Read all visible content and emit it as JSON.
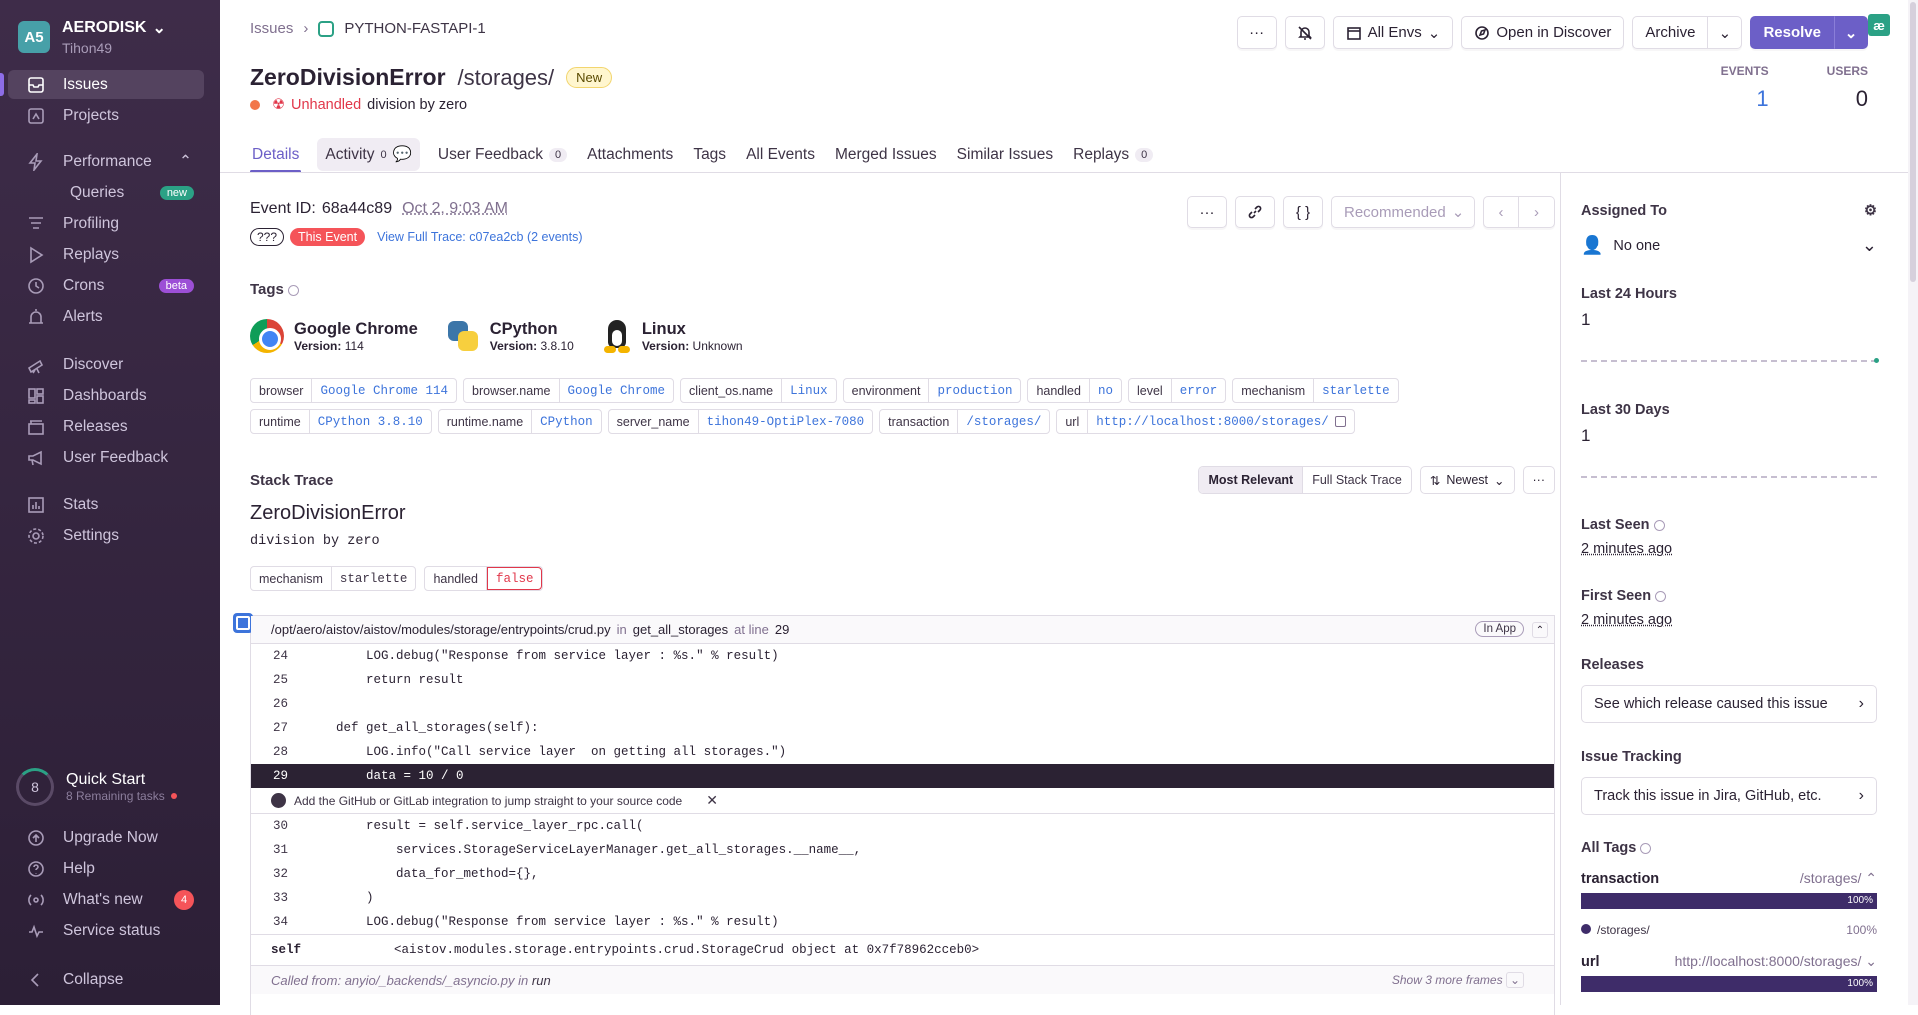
{
  "org": {
    "initials": "A5",
    "name": "AERODISK",
    "user": "Tihon49"
  },
  "nav": {
    "issues": "Issues",
    "projects": "Projects",
    "performance": "Performance",
    "queries": "Queries",
    "queries_badge": "new",
    "profiling": "Profiling",
    "replays": "Replays",
    "crons": "Crons",
    "crons_badge": "beta",
    "alerts": "Alerts",
    "discover": "Discover",
    "dashboards": "Dashboards",
    "releases": "Releases",
    "user_feedback": "User Feedback",
    "stats": "Stats",
    "settings": "Settings"
  },
  "quickstart": {
    "count": "8",
    "title": "Quick Start",
    "sub": "8 Remaining tasks"
  },
  "footer_nav": {
    "upgrade": "Upgrade Now",
    "help": "Help",
    "whats_new": "What's new",
    "whats_new_count": "4",
    "service_status": "Service status",
    "collapse": "Collapse"
  },
  "breadcrumb": {
    "root": "Issues",
    "project": "PYTHON-FASTAPI-1"
  },
  "toolbar": {
    "more": "···",
    "envs": "All Envs",
    "discover": "Open in Discover",
    "archive": "Archive",
    "resolve": "Resolve",
    "logo": "æ"
  },
  "issue": {
    "title": "ZeroDivisionError",
    "path": "/storages/",
    "status": "New",
    "unhandled": "Unhandled",
    "message": "division by zero"
  },
  "stats": {
    "events_label": "EVENTS",
    "events": "1",
    "users_label": "USERS",
    "users": "0"
  },
  "tabs": [
    {
      "label": "Details"
    },
    {
      "label": "Activity",
      "count": "0"
    },
    {
      "label": "User Feedback",
      "count": "0"
    },
    {
      "label": "Attachments"
    },
    {
      "label": "Tags"
    },
    {
      "label": "All Events"
    },
    {
      "label": "Merged Issues"
    },
    {
      "label": "Similar Issues"
    },
    {
      "label": "Replays",
      "count": "0"
    }
  ],
  "event": {
    "label": "Event ID:",
    "id": "68a44c89",
    "date": "Oct 2, 9:03 AM",
    "q": "???",
    "this_event": "This Event",
    "trace": "View Full Trace: c07ea2cb (2 events)",
    "recommended": "Recommended"
  },
  "tags_title": "Tags",
  "contexts": [
    {
      "name": "Google Chrome",
      "ver_label": "Version:",
      "ver": "114"
    },
    {
      "name": "CPython",
      "ver_label": "Version:",
      "ver": "3.8.10"
    },
    {
      "name": "Linux",
      "ver_label": "Version:",
      "ver": "Unknown"
    }
  ],
  "tag_list": [
    {
      "k": "browser",
      "v": "Google Chrome 114"
    },
    {
      "k": "browser.name",
      "v": "Google Chrome"
    },
    {
      "k": "client_os.name",
      "v": "Linux"
    },
    {
      "k": "environment",
      "v": "production"
    },
    {
      "k": "handled",
      "v": "no"
    },
    {
      "k": "level",
      "v": "error"
    },
    {
      "k": "mechanism",
      "v": "starlette"
    },
    {
      "k": "runtime",
      "v": "CPython 3.8.10"
    },
    {
      "k": "runtime.name",
      "v": "CPython"
    },
    {
      "k": "server_name",
      "v": "tihon49-OptiPlex-7080"
    },
    {
      "k": "transaction",
      "v": "/storages/"
    },
    {
      "k": "url",
      "v": "http://localhost:8000/storages/"
    }
  ],
  "stack": {
    "title": "Stack Trace",
    "most_relevant": "Most Relevant",
    "full": "Full Stack Trace",
    "sort": "Newest",
    "exc_type": "ZeroDivisionError",
    "exc_msg": "division by zero",
    "mech_k": "mechanism",
    "mech_v": "starlette",
    "handled_k": "handled",
    "handled_v": "false",
    "file": "/opt/aero/aistov/aistov/modules/storage/entrypoints/crud.py",
    "in": "in",
    "func": "get_all_storages",
    "at": "at line",
    "line": "29",
    "in_app": "In App",
    "lines": [
      {
        "n": "24",
        "c": "        LOG.debug(\"Response from service layer : %s.\" % result)"
      },
      {
        "n": "25",
        "c": "        return result"
      },
      {
        "n": "26",
        "c": ""
      },
      {
        "n": "27",
        "c": "    def get_all_storages(self):"
      },
      {
        "n": "28",
        "c": "        LOG.info(\"Call service layer  on getting all storages.\")"
      },
      {
        "n": "29",
        "c": "        data = 10 / 0"
      }
    ],
    "integration": "Add the GitHub or GitLab integration to jump straight to your source code",
    "lines2": [
      {
        "n": "30",
        "c": "        result = self.service_layer_rpc.call("
      },
      {
        "n": "31",
        "c": "            services.StorageServiceLayerManager.get_all_storages.__name__,"
      },
      {
        "n": "32",
        "c": "            data_for_method={},"
      },
      {
        "n": "33",
        "c": "        )"
      },
      {
        "n": "34",
        "c": "        LOG.debug(\"Response from service layer : %s.\" % result)"
      }
    ],
    "var_k": "self",
    "var_v": "<aistov.modules.storage.entrypoints.crud.StorageCrud object at 0x7f78962cceb0>",
    "called": "Called from: anyio/_backends/_asyncio.py",
    "called_in": "in",
    "called_fn": "run",
    "show_more": "Show 3 more frames"
  },
  "right": {
    "assigned": "Assigned To",
    "no_one": "No one",
    "last24": "Last 24 Hours",
    "last24_v": "1",
    "last30": "Last 30 Days",
    "last30_v": "1",
    "last_seen": "Last Seen",
    "last_seen_v": "2 minutes ago",
    "first_seen": "First Seen",
    "first_seen_v": "2 minutes ago",
    "releases": "Releases",
    "releases_btn": "See which release caused this issue",
    "tracking": "Issue Tracking",
    "tracking_btn": "Track this issue in Jira, GitHub, etc.",
    "all_tags": "All Tags",
    "tag1_k": "transaction",
    "tag1_v": "/storages/",
    "tag1_pct": "100%",
    "tag1_leg": "/storages/",
    "tag1_leg_pct": "100%",
    "tag2_k": "url",
    "tag2_v": "http://localhost:8000/storages/",
    "tag2_pct": "100%"
  }
}
